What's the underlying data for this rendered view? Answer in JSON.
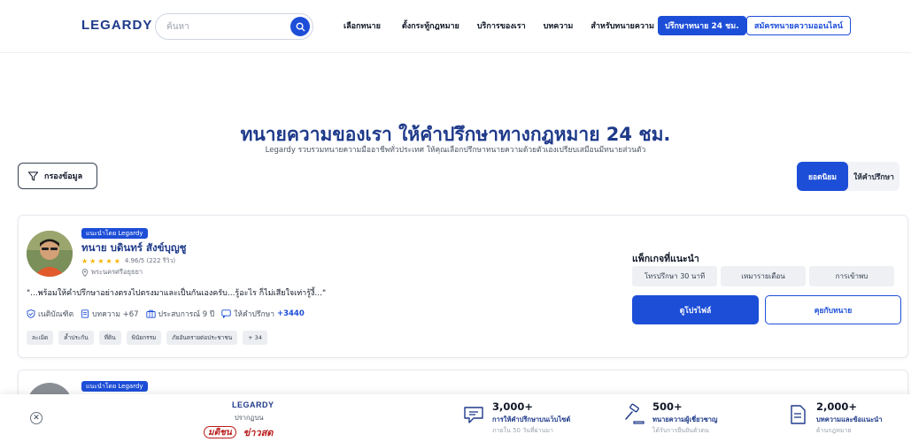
{
  "header": {
    "logo": "LEGARDY",
    "search": {
      "placeholder": "ค้นหา",
      "value": ""
    },
    "nav": [
      "เลือกทนาย",
      "ตั้งกระทู้กฎหมาย",
      "บริการของเรา",
      "บทความ",
      "สำหรับทนายความ"
    ],
    "cta_primary": "ปรึกษาทนาย 24 ชม.",
    "cta_outline": "สมัครทนายความออนไลน์"
  },
  "hero": {
    "title": "ทนายความของเรา ให้คำปรึกษาทางกฎหมาย 24 ชม.",
    "subtitle": "Legardy รวบรวมทนายความมืออาชีพทั่วประเทศ ให้คุณเลือกปรึกษาทนายความด้วยตัวเองเปรียบเสมือนมีทนายส่วนตัว"
  },
  "filter": {
    "label": "กรองข้อมูล"
  },
  "sort": {
    "options": [
      "ยอดนิยม",
      "ให้คำปรึกษา"
    ],
    "active": "ยอดนิยม"
  },
  "lawyers": [
    {
      "badge": "แนะนำโดย Legardy",
      "name": "ทนาย บดินทร์ สังข์บุญชู",
      "rating": 4.96,
      "rating_text": "4.96/5 (222 รีวิว)",
      "location": "พระนครศรีอยุธยา",
      "quote": "\"...พร้อมให้คำปรึกษาอย่างตรงไปตรงมาและเป็นกันเองครับ...รู้อะไร ก็ไม่เสียใจเท่ารู้งี้...\"",
      "stats": {
        "degree": "เนติบัณฑิต",
        "articles": "บทความ +67",
        "experience": "ประสบการณ์ 9 ปี",
        "consult_label": "ให้คำปรึกษา",
        "consult_count": "+3440"
      },
      "tags": [
        "ละเมิด",
        "ค้ำประกัน",
        "ที่ดิน",
        "พินัยกรรม",
        "ภัยอันตรายต่อประชาชน",
        "+ 34"
      ],
      "packages_title": "แพ็กเกจที่แนะนำ",
      "packages": [
        "โทรปรึกษา 30 นาที",
        "เหมารายเดือน",
        "การเข้าพบ"
      ],
      "profile_button": "ดูโปรไฟล์",
      "chat_button": "คุยกับทนาย"
    },
    {
      "badge": "แนะนำโดย Legardy"
    }
  ],
  "banner": {
    "close": "✕",
    "logo": "LEGARDY",
    "appear_label": "ปรากฏบน",
    "media": [
      "มติชน",
      "ข่าวสด"
    ],
    "stats": [
      {
        "icon": "chat-icon",
        "number": "3,000+",
        "label": "การให้คำปรึกษาบนเว็บไซต์",
        "sub": "ภายใน 50 วันที่ผ่านมา"
      },
      {
        "icon": "gavel-icon",
        "number": "500+",
        "label": "ทนายความผู้เชี่ยวชาญ",
        "sub": "ได้รับการยืนยันตัวตน"
      },
      {
        "icon": "document-icon",
        "number": "2,000+",
        "label": "บทความและข้อแนะนำ",
        "sub": "ด้านกฎหมาย"
      }
    ]
  },
  "colors": {
    "primary": "#1d4ed8",
    "heading": "#1e3a8a",
    "star": "#f5b700"
  }
}
